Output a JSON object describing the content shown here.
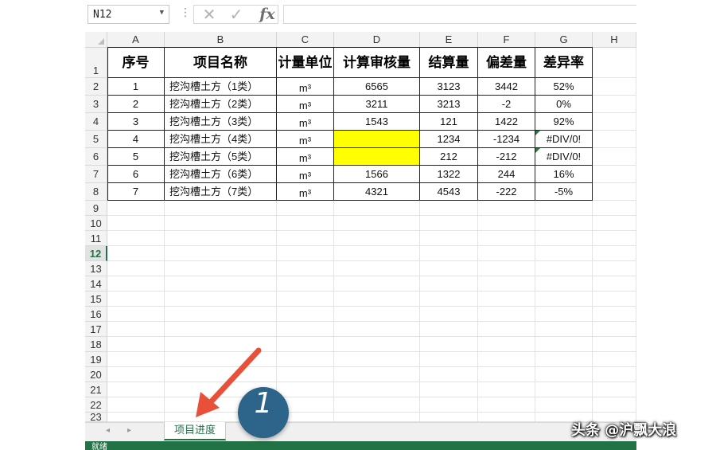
{
  "formula_bar": {
    "name_box": "N12",
    "dots": "⋮",
    "cancel_icon": "✕",
    "enter_icon": "✓",
    "fx_label": "fx",
    "formula_value": ""
  },
  "columns": [
    "A",
    "B",
    "C",
    "D",
    "E",
    "F",
    "G",
    "H"
  ],
  "rows": [
    "1",
    "2",
    "3",
    "4",
    "5",
    "6",
    "7",
    "8",
    "9",
    "10",
    "11",
    "12",
    "13",
    "14",
    "15",
    "16",
    "17",
    "18",
    "19",
    "20",
    "21",
    "22",
    "23"
  ],
  "active_row": "12",
  "table": {
    "headers": [
      "序号",
      "项目名称",
      "计量单位",
      "计算审核量",
      "结算量",
      "偏差量",
      "差异率"
    ],
    "rows": [
      [
        "1",
        "挖沟槽土方（1类）",
        "m³",
        "6565",
        "3123",
        "3442",
        "52%"
      ],
      [
        "2",
        "挖沟槽土方（2类）",
        "m³",
        "3211",
        "3213",
        "-2",
        "0%"
      ],
      [
        "3",
        "挖沟槽土方（3类）",
        "m³",
        "1543",
        "121",
        "1422",
        "92%"
      ],
      [
        "4",
        "挖沟槽土方（4类）",
        "m³",
        "",
        "1234",
        "-1234",
        "#DIV/0!"
      ],
      [
        "5",
        "挖沟槽土方（5类）",
        "m³",
        "",
        "212",
        "-212",
        "#DIV/0!"
      ],
      [
        "6",
        "挖沟槽土方（6类）",
        "m³",
        "1566",
        "1322",
        "244",
        "16%"
      ],
      [
        "7",
        "挖沟槽土方（7类）",
        "m³",
        "4321",
        "4543",
        "-222",
        "-5%"
      ]
    ],
    "highlight_color": "#ffff00",
    "error_indicator_color": "#1e7b3a"
  },
  "sheet_tabs": {
    "nav_prev": "◂",
    "nav_next": "▸",
    "active_tab": "项目进度"
  },
  "status_bar": {
    "text": "就绪"
  },
  "annotation": {
    "badge": "1",
    "arrow_color": "#e8503a"
  },
  "watermark": "头条 @沪飘大浪",
  "colors": {
    "excel_green": "#217346",
    "badge": "#2d6489"
  }
}
